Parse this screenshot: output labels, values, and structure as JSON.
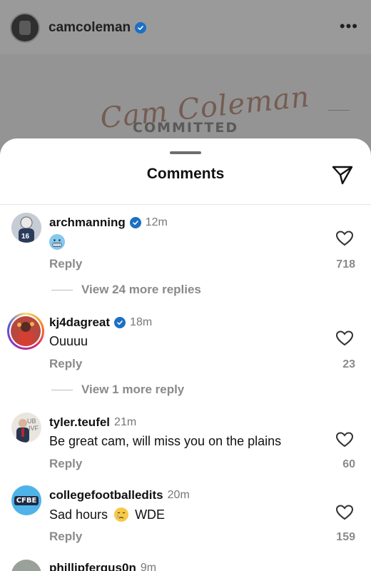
{
  "post": {
    "username": "camcoleman",
    "more_label": "•••",
    "script_text": "Cam Coleman",
    "overlay_text": "COMMITTED"
  },
  "sheet": {
    "title": "Comments"
  },
  "comments": [
    {
      "username": "archmanning",
      "verified": true,
      "time": "12m",
      "text": "",
      "emoji": "cold-face-emoji",
      "reply_label": "Reply",
      "likes": "718",
      "view_more": "View 24 more replies"
    },
    {
      "username": "kj4dagreat",
      "verified": true,
      "time": "18m",
      "text": "Ouuuu",
      "reply_label": "Reply",
      "likes": "23",
      "view_more": "View 1 more reply"
    },
    {
      "username": "tyler.teufel",
      "verified": false,
      "time": "21m",
      "text": "Be great cam, will miss you on the plains",
      "reply_label": "Reply",
      "likes": "60"
    },
    {
      "username": "collegefootballedits",
      "verified": false,
      "time": "20m",
      "text_before": "Sad hours",
      "emoji": "crying-face-emoji",
      "text_after": "WDE",
      "reply_label": "Reply",
      "likes": "159",
      "avatar_text": "CFBE"
    },
    {
      "username": "phillipfergus0n",
      "verified": false,
      "time": "9m"
    }
  ],
  "colors": {
    "verified": "#1d6fc4",
    "muted": "#8a8a8a",
    "story_ring": "#d62976"
  }
}
